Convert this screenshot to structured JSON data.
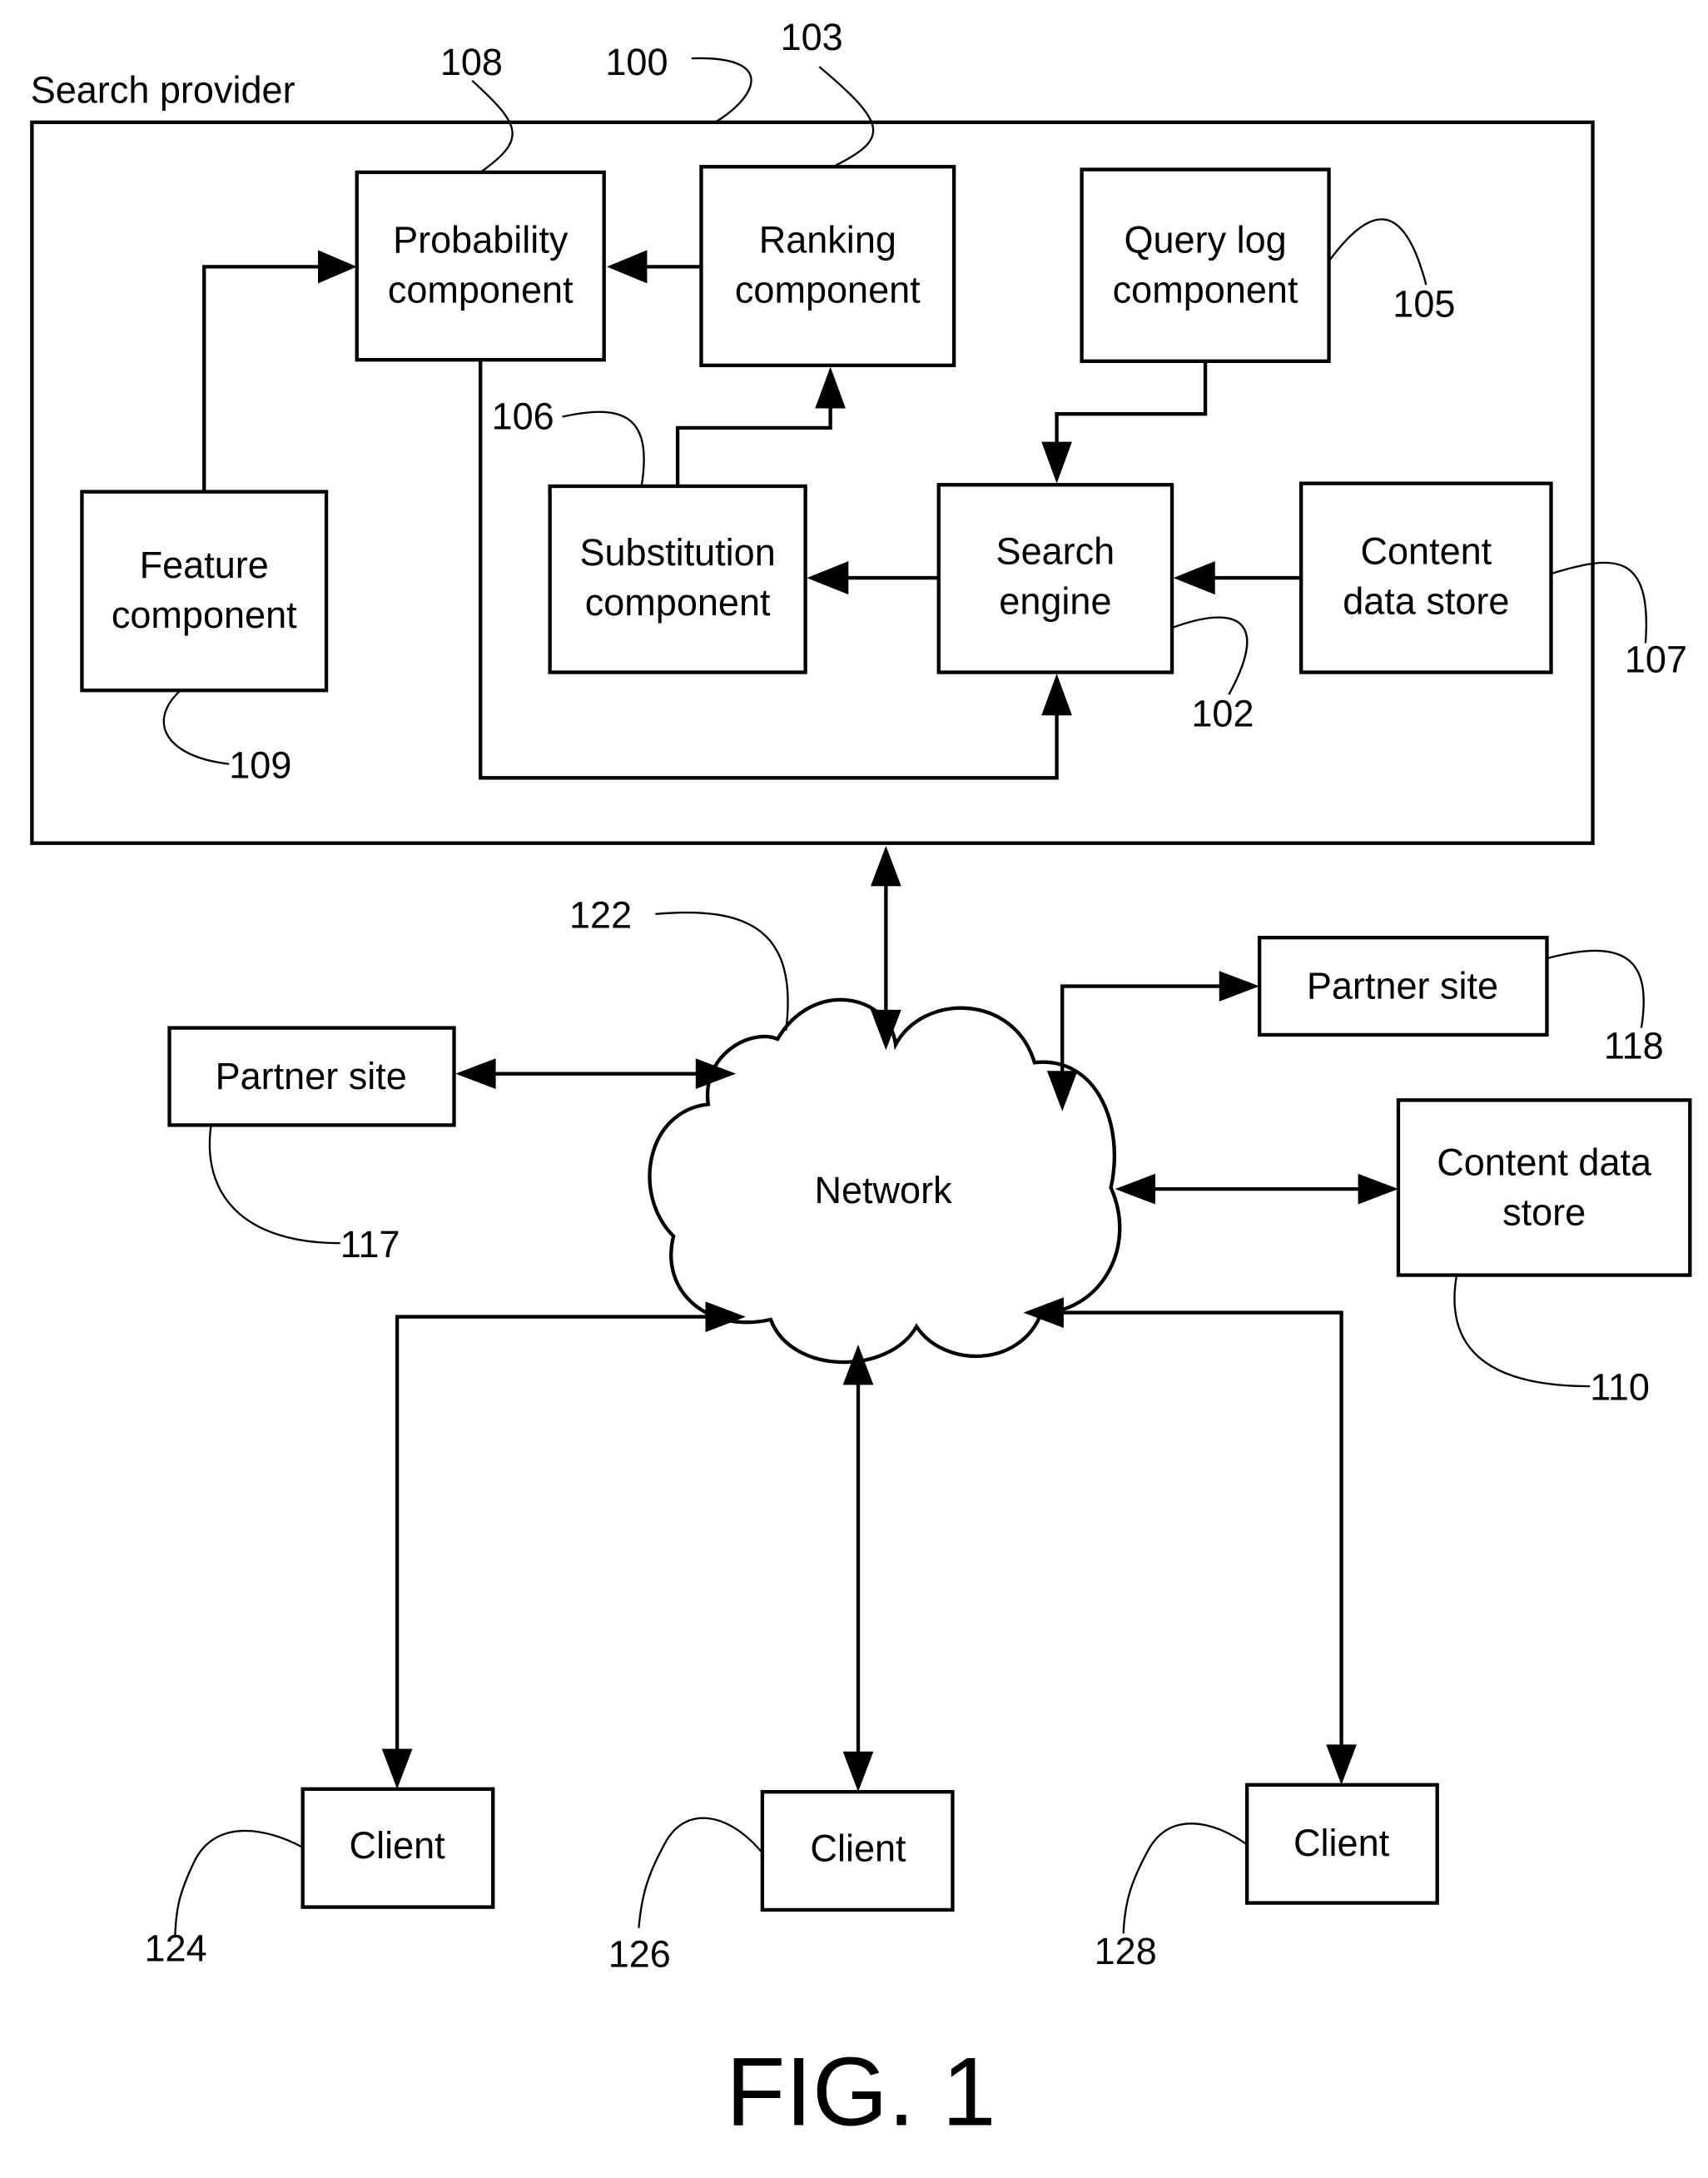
{
  "figure": {
    "title": "FIG. 1",
    "group_label": "Search provider",
    "group_ref": "100"
  },
  "nodes": {
    "probability": {
      "line1": "Probability",
      "line2": "component",
      "ref": "108"
    },
    "ranking": {
      "line1": "Ranking",
      "line2": "component",
      "ref": "103"
    },
    "query_log": {
      "line1": "Query log",
      "line2": "component",
      "ref": "105"
    },
    "feature": {
      "line1": "Feature",
      "line2": "component",
      "ref": "109"
    },
    "substitution": {
      "line1": "Substitution",
      "line2": "component",
      "ref": "106"
    },
    "search_engine": {
      "line1": "Search",
      "line2": "engine",
      "ref": "102"
    },
    "content_store_inner": {
      "line1": "Content",
      "line2": "data store",
      "ref": "107"
    },
    "network": {
      "label": "Network",
      "ref": "122"
    },
    "partner_left": {
      "label": "Partner site",
      "ref": "117"
    },
    "partner_right": {
      "label": "Partner site",
      "ref": "118"
    },
    "content_store_outer": {
      "line1": "Content data",
      "line2": "store",
      "ref": "110"
    },
    "client_1": {
      "label": "Client",
      "ref": "124"
    },
    "client_2": {
      "label": "Client",
      "ref": "126"
    },
    "client_3": {
      "label": "Client",
      "ref": "128"
    }
  },
  "edges": [
    {
      "from": "feature",
      "to": "probability"
    },
    {
      "from": "ranking",
      "to": "probability"
    },
    {
      "from": "substitution",
      "to": "ranking"
    },
    {
      "from": "query_log",
      "to": "search_engine"
    },
    {
      "from": "content_store_inner",
      "to": "search_engine"
    },
    {
      "from": "search_engine",
      "to": "substitution"
    },
    {
      "from": "probability",
      "to": "search_engine"
    },
    {
      "from": "search_provider",
      "to": "network",
      "bidirectional": true
    },
    {
      "from": "partner_left",
      "to": "network",
      "bidirectional": true
    },
    {
      "from": "partner_right",
      "to": "network",
      "bidirectional": true
    },
    {
      "from": "content_store_outer",
      "to": "network",
      "bidirectional": true
    },
    {
      "from": "client_1",
      "to": "network",
      "bidirectional": true
    },
    {
      "from": "client_2",
      "to": "network",
      "bidirectional": true
    },
    {
      "from": "client_3",
      "to": "network",
      "bidirectional": true
    }
  ]
}
